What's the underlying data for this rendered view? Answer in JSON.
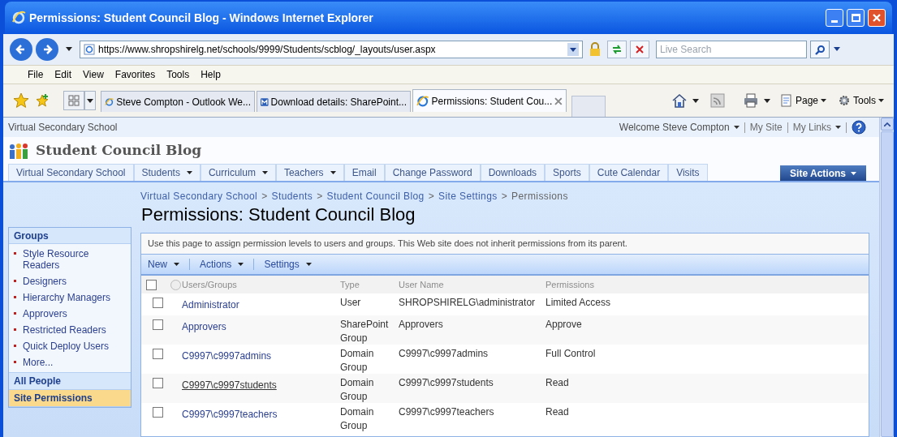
{
  "window": {
    "title": "Permissions: Student Council Blog - Windows Internet Explorer"
  },
  "address_bar": {
    "url": "https://www.shropshirelg.net/schools/9999/Students/scblog/_layouts/user.aspx"
  },
  "search": {
    "placeholder": "Live Search"
  },
  "menu": [
    "File",
    "Edit",
    "View",
    "Favorites",
    "Tools",
    "Help"
  ],
  "tabs": [
    {
      "label": "Steve Compton - Outlook We...",
      "kind": "ie",
      "selected": false
    },
    {
      "label": "Download details: SharePoint...",
      "kind": "msdn",
      "selected": false
    },
    {
      "label": "Permissions: Student Cou...",
      "kind": "ie",
      "selected": true
    }
  ],
  "command_bar": [
    "Page",
    "Tools"
  ],
  "site": {
    "parent_site": "Virtual Secondary School",
    "welcome": "Welcome Steve Compton",
    "links": [
      {
        "label": "My Site",
        "dropdown": false
      },
      {
        "label": "My Links",
        "dropdown": true
      }
    ],
    "title": "Student Council Blog"
  },
  "nav_tabs": [
    {
      "label": "Virtual Secondary School",
      "dropdown": false
    },
    {
      "label": "Students",
      "dropdown": true
    },
    {
      "label": "Curriculum",
      "dropdown": true
    },
    {
      "label": "Teachers",
      "dropdown": true
    },
    {
      "label": "Email",
      "dropdown": false
    },
    {
      "label": "Change Password",
      "dropdown": false
    },
    {
      "label": "Downloads",
      "dropdown": false
    },
    {
      "label": "Sports",
      "dropdown": false
    },
    {
      "label": "Cute Calendar",
      "dropdown": false
    },
    {
      "label": "Visits",
      "dropdown": false
    }
  ],
  "site_actions": "Site Actions",
  "breadcrumb": {
    "separator": ">",
    "items": [
      "Virtual Secondary School",
      "Students",
      "Student Council Blog",
      "Site Settings",
      "Permissions"
    ]
  },
  "page_title": "Permissions: Student Council Blog",
  "quick_launch": {
    "heading": "Groups",
    "items": [
      "Style Resource Readers",
      "Designers",
      "Hierarchy Managers",
      "Approvers",
      "Restricted Readers",
      "Quick Deploy Users",
      "More..."
    ],
    "sections": [
      {
        "label": "All People",
        "selected": false
      },
      {
        "label": "Site Permissions",
        "selected": true
      }
    ]
  },
  "description": "Use this page to assign permission levels to users and groups. This Web site does not inherit permissions from its parent.",
  "list_toolbar": [
    "New",
    "Actions",
    "Settings"
  ],
  "table": {
    "select_all_checked": false,
    "columns": [
      "Users/Groups",
      "Type",
      "User Name",
      "Permissions"
    ],
    "rows": [
      {
        "checked": false,
        "hovered": false,
        "name": "Administrator",
        "type": "User",
        "user_name": "SHROPSHIRELG\\administrator",
        "permissions": "Limited Access"
      },
      {
        "checked": false,
        "hovered": false,
        "name": "Approvers",
        "type": "SharePoint Group",
        "user_name": "Approvers",
        "permissions": "Approve"
      },
      {
        "checked": false,
        "hovered": false,
        "name": "C9997\\c9997admins",
        "type": "Domain Group",
        "user_name": "C9997\\c9997admins",
        "permissions": "Full Control"
      },
      {
        "checked": false,
        "hovered": true,
        "name": "C9997\\c9997students",
        "type": "Domain Group",
        "user_name": "C9997\\c9997students",
        "permissions": "Read"
      },
      {
        "checked": false,
        "hovered": false,
        "name": "C9997\\c9997teachers",
        "type": "Domain Group",
        "user_name": "C9997\\c9997teachers",
        "permissions": "Read"
      }
    ]
  }
}
